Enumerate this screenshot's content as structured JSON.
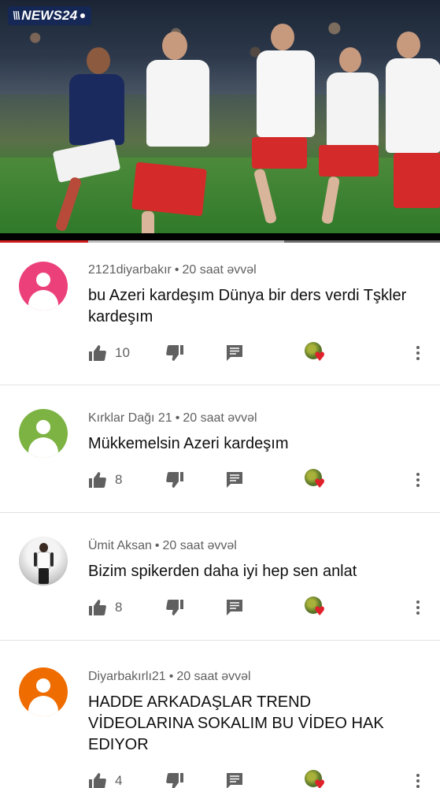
{
  "video": {
    "channel_logo": "NEWS24",
    "progress_played": 0.2,
    "progress_buffered": 0.645,
    "colors": {
      "progress": "#d11d1d",
      "logo_bg": "#14285a"
    }
  },
  "comments": [
    {
      "author": "2121diyarbakır",
      "time": "20 saat əvvəl",
      "text": "bu Azeri kardeşım Dünya bir ders verdi Tşkler kardeşım",
      "likes": "10",
      "avatar_color": "#ec407a",
      "avatar_type": "default"
    },
    {
      "author": "Kırklar Dağı 21",
      "time": "20 saat əvvəl",
      "text": "Mükkemelsin Azeri kardeşım",
      "likes": "8",
      "avatar_color": "#7cb342",
      "avatar_type": "default"
    },
    {
      "author": "Ümit Aksan",
      "time": "20 saat əvvəl",
      "text": "Bizim spikerden daha iyi hep sen anlat",
      "likes": "8",
      "avatar_color": "#e9ecef",
      "avatar_type": "photo"
    },
    {
      "author": "Diyarbakırlı21",
      "time": "20 saat əvvəl",
      "text": "HADDE ARKADAŞLAR TREND VİDEOLARINA SOKALIM BU VİDEO HAK EDIYOR",
      "likes": "4",
      "avatar_color": "#ef6c00",
      "avatar_type": "default"
    }
  ],
  "icons": {
    "like": "thumbs-up-icon",
    "dislike": "thumbs-down-icon",
    "reply": "reply-comment-icon",
    "creator_heart": "creator-heart-icon",
    "more": "more-vert-icon"
  }
}
